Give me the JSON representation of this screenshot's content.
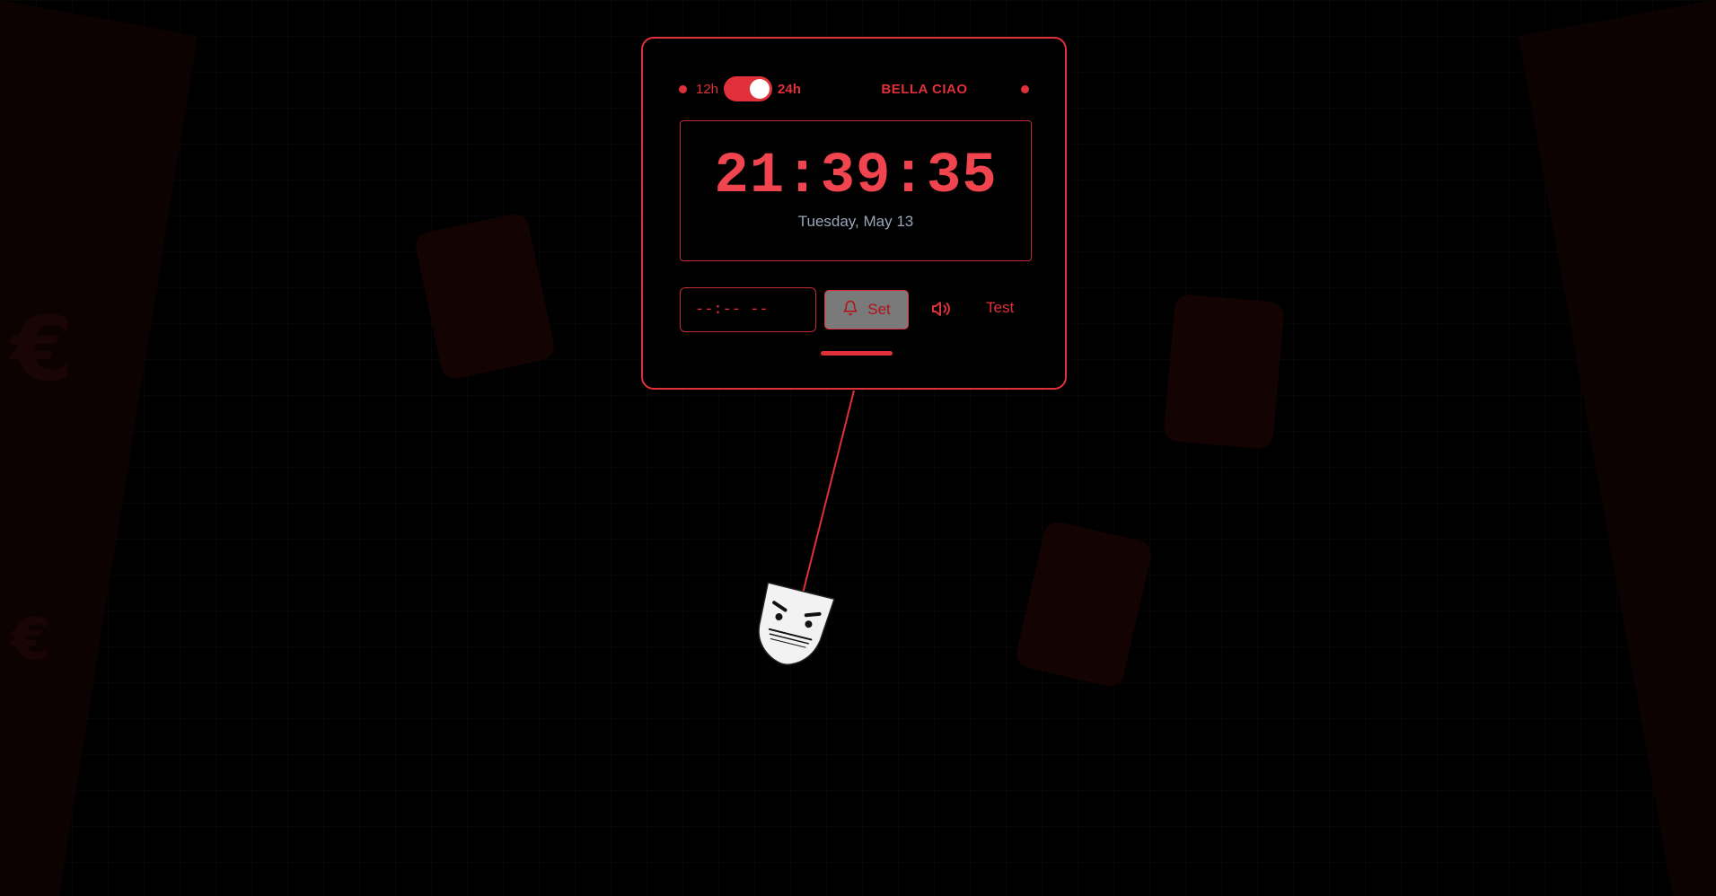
{
  "clock": {
    "format_12_label": "12h",
    "format_24_label": "24h",
    "format_24h_enabled": true,
    "song_title": "BELLA CIAO",
    "time": "21:39:35",
    "date": "Tuesday, May 13"
  },
  "alarm": {
    "time_placeholder": "--:-- --",
    "set_label": "Set",
    "test_label": "Test"
  },
  "background": {
    "currency_symbol": "€"
  },
  "icons": {
    "set": "bell-icon",
    "sound": "speaker-icon",
    "mascot": "mask-face-icon"
  },
  "colors": {
    "accent": "#e0303a",
    "background": "#000000",
    "date_text": "#9aa6b8"
  }
}
